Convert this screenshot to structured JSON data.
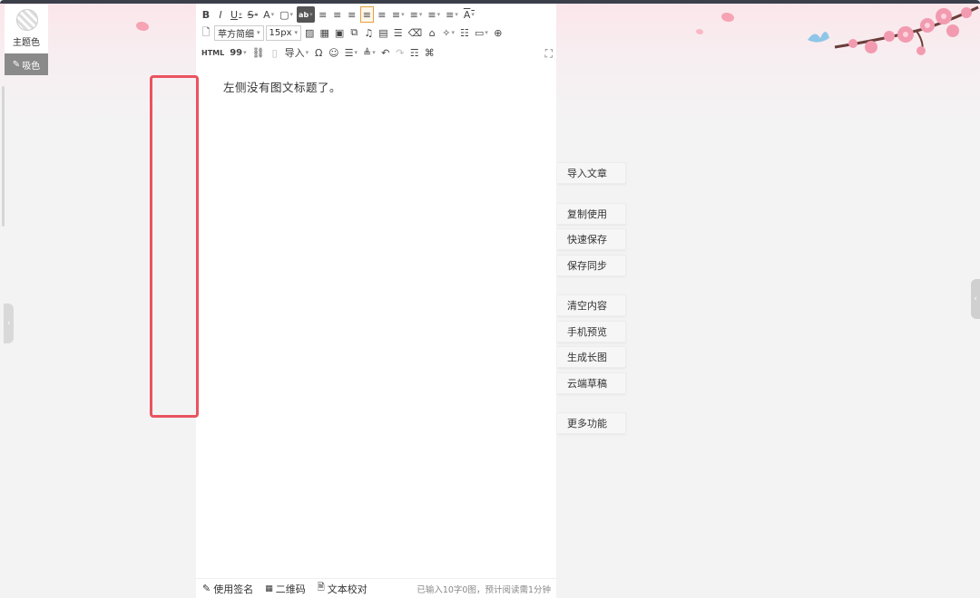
{
  "left_panel": {
    "theme_label": "主题色",
    "pick_color_label": "吸色"
  },
  "toolbar": {
    "row1": [
      "B",
      "I",
      "U",
      "S",
      "A",
      "▢",
      "ab",
      "≡",
      "≡",
      "≡",
      "≡",
      "≡",
      "≡",
      "≡",
      "≡",
      "≡",
      "A"
    ],
    "font_family": "苹方简细",
    "font_size": "15px",
    "html_label": "HTML",
    "quote_label": "99",
    "import_label": "导入"
  },
  "editor": {
    "content": "左侧没有图文标题了。"
  },
  "bottom_bar": {
    "signature": "使用签名",
    "qrcode": "二维码",
    "proofread": "文本校对",
    "stats": "已输入10字0图，预计阅读需1分钟"
  },
  "actions": [
    {
      "label": "导入文章"
    },
    {
      "label": "复制使用"
    },
    {
      "label": "快速保存"
    },
    {
      "label": "保存同步"
    },
    {
      "label": "清空内容"
    },
    {
      "label": "手机预览"
    },
    {
      "label": "生成长图"
    },
    {
      "label": "云端草稿"
    },
    {
      "label": "更多功能"
    }
  ],
  "colors": {
    "accent_highlight": "#e95360",
    "active_tool": "#e8a23c",
    "pick_button": "#8a8a8a"
  }
}
